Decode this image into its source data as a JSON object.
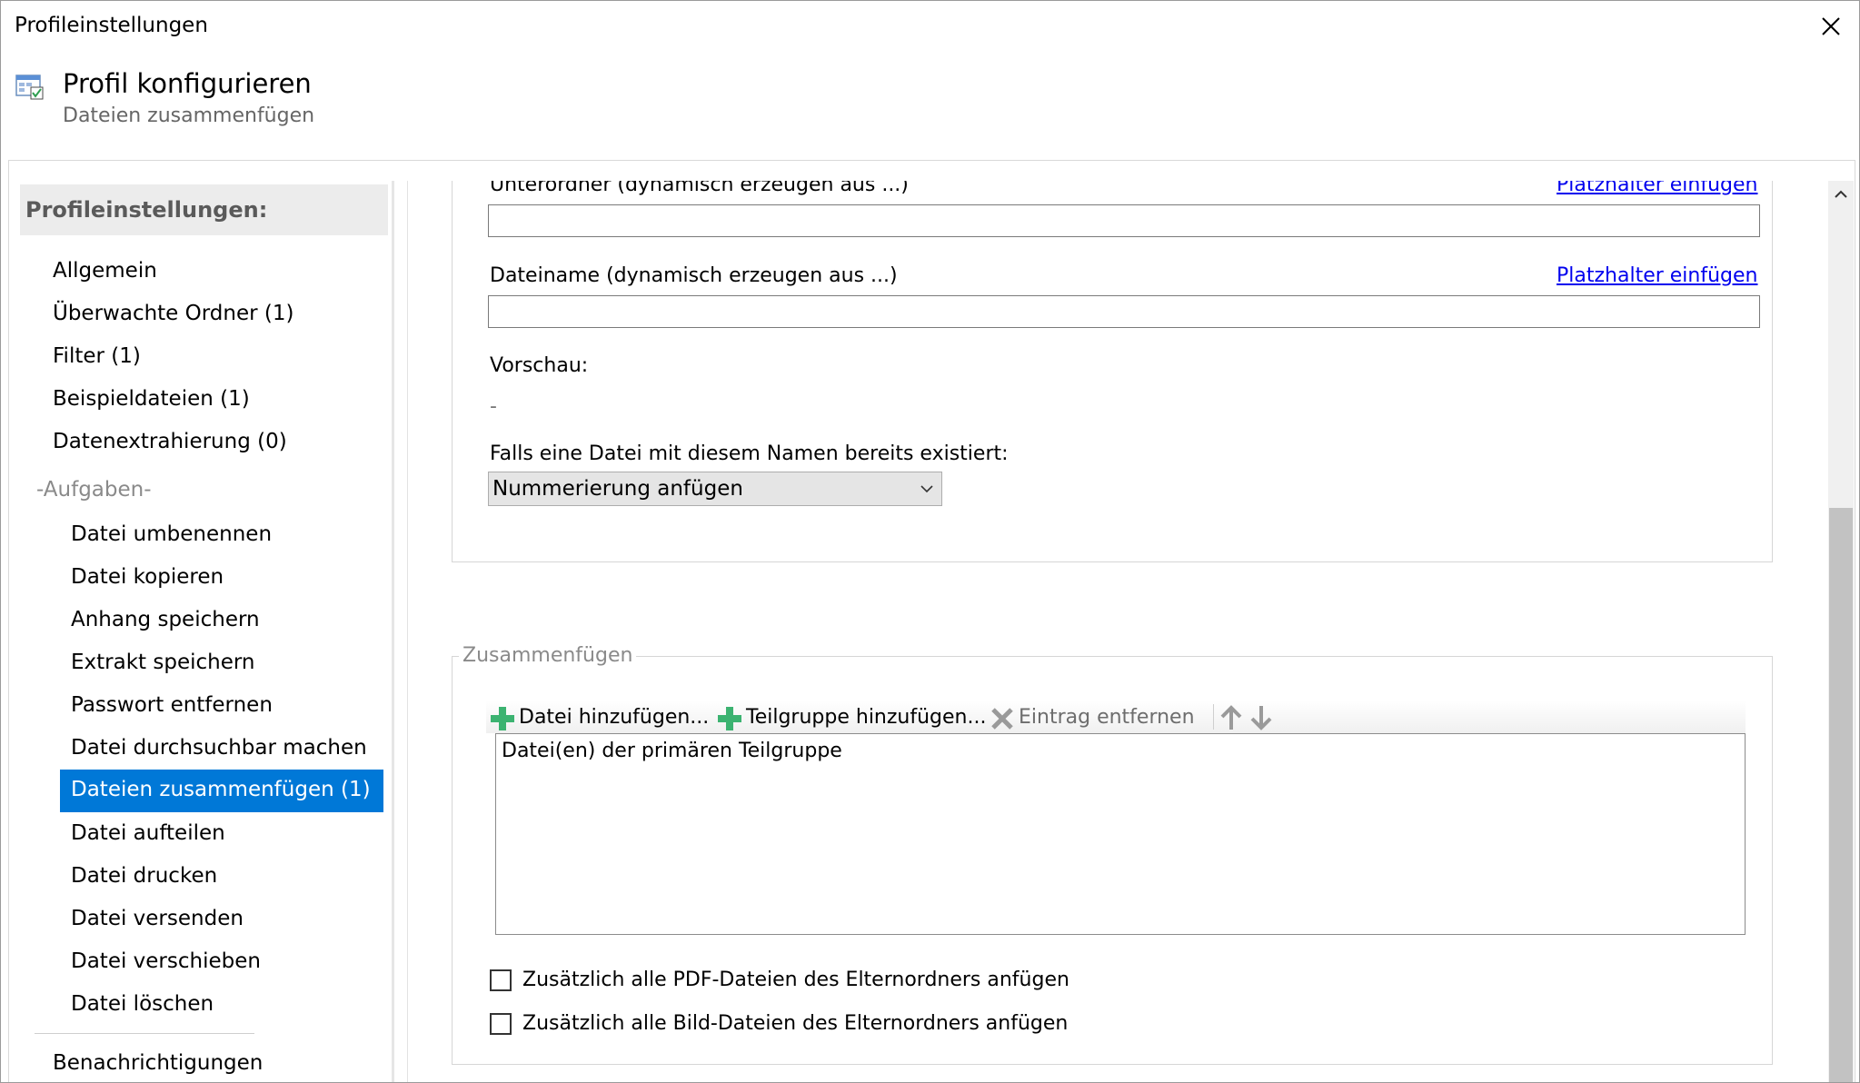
{
  "window": {
    "title": "Profileinstellungen"
  },
  "header": {
    "title": "Profil konfigurieren",
    "subtitle": "Dateien zusammenfügen",
    "icon": "profile-settings-icon"
  },
  "sidebar": {
    "heading": "Profileinstellungen:",
    "items": [
      {
        "label": "Allgemein"
      },
      {
        "label": "Überwachte Ordner (1)"
      },
      {
        "label": "Filter (1)"
      },
      {
        "label": "Beispieldateien (1)"
      },
      {
        "label": "Datenextrahierung (0)"
      }
    ],
    "tasks_group": "-Aufgaben-",
    "tasks": [
      {
        "label": "Datei umbenennen"
      },
      {
        "label": "Datei kopieren"
      },
      {
        "label": "Anhang speichern"
      },
      {
        "label": "Extrakt speichern"
      },
      {
        "label": "Passwort entfernen"
      },
      {
        "label": "Datei durchsuchbar machen"
      },
      {
        "label": "Dateien zusammenfügen (1)",
        "selected": true
      },
      {
        "label": "Datei aufteilen"
      },
      {
        "label": "Datei drucken"
      },
      {
        "label": "Datei versenden"
      },
      {
        "label": "Datei verschieben"
      },
      {
        "label": "Datei löschen"
      }
    ],
    "footer_items": [
      {
        "label": "Benachrichtigungen"
      }
    ]
  },
  "main": {
    "subfolder_label": "Unterordner (dynamisch erzeugen aus ...)",
    "subfolder_value": "",
    "insert_placeholder_link": "Platzhalter einfügen",
    "filename_label": "Dateiname (dynamisch erzeugen aus ...)",
    "filename_value": "",
    "preview_label": "Vorschau:",
    "preview_value": "-",
    "exists_label": "Falls eine Datei mit diesem Namen bereits existiert:",
    "exists_selected": "Nummerierung anfügen",
    "merge_group": {
      "title": "Zusammenfügen",
      "toolbar": {
        "add_file": "Datei hinzufügen...",
        "add_subgroup": "Teilgruppe hinzufügen...",
        "remove_entry": "Eintrag entfernen"
      },
      "list_items": [
        "Datei(en) der primären Teilgruppe"
      ],
      "checkboxes": [
        {
          "label": "Zusätzlich alle PDF-Dateien des Elternordners anfügen",
          "checked": false
        },
        {
          "label": "Zusätzlich alle Bild-Dateien des Elternordners anfügen",
          "checked": false
        }
      ]
    }
  },
  "colors": {
    "selection": "#0078d7",
    "link": "#0000ee",
    "add_icon": "#3cb371",
    "disabled": "#9a9a9a"
  }
}
